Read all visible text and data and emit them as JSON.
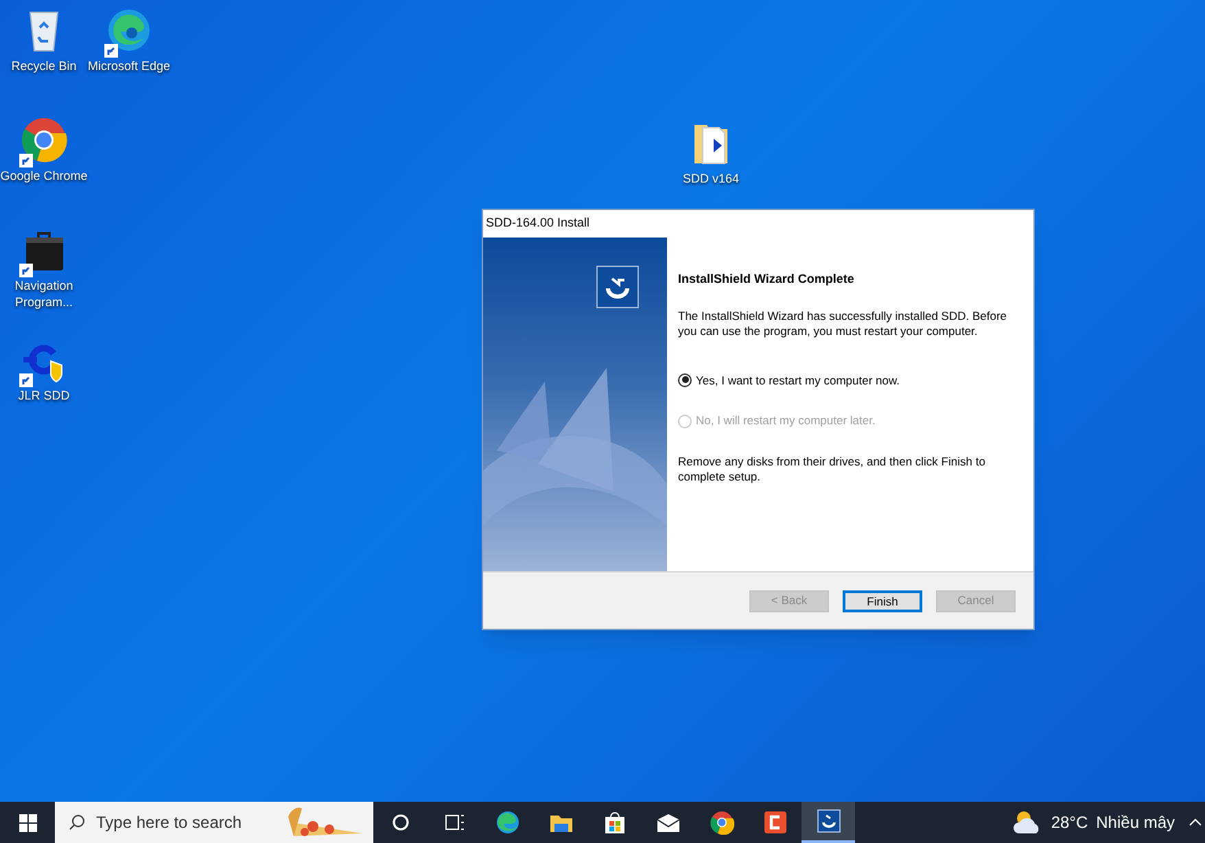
{
  "desktop_icons": [
    {
      "kind": "recycle-bin",
      "label": "Recycle Bin"
    },
    {
      "kind": "edge",
      "label": "Microsoft Edge"
    },
    {
      "kind": "chrome",
      "label": "Google Chrome"
    },
    {
      "kind": "briefcase",
      "label": "Navigation Program..."
    },
    {
      "kind": "jlr",
      "label": "JLR SDD"
    },
    {
      "kind": "folder",
      "label": "SDD v164"
    }
  ],
  "dialog": {
    "title": "SDD-164.00 Install",
    "heading": "InstallShield Wizard Complete",
    "message": "The InstallShield Wizard has successfully installed SDD. Before you can use the program, you must restart your computer.",
    "options": [
      {
        "label": "Yes, I want to restart my computer now.",
        "selected": true,
        "disabled": false
      },
      {
        "label": "No, I will restart my computer later.",
        "selected": false,
        "disabled": true
      }
    ],
    "note": "Remove any disks from their drives, and then click Finish to complete setup.",
    "buttons": [
      {
        "label": "< Back",
        "disabled": true,
        "default": false
      },
      {
        "label": "Finish",
        "disabled": false,
        "default": true
      },
      {
        "label": "Cancel",
        "disabled": true,
        "default": false
      }
    ]
  },
  "taskbar": {
    "search": {
      "placeholder": "Type here to search"
    },
    "apps": [
      {
        "kind": "cortana",
        "active": false
      },
      {
        "kind": "task-view",
        "active": false
      },
      {
        "kind": "edge",
        "active": false
      },
      {
        "kind": "explorer",
        "active": false
      },
      {
        "kind": "store",
        "active": false
      },
      {
        "kind": "mail",
        "active": false
      },
      {
        "kind": "chrome",
        "active": false
      },
      {
        "kind": "red-app",
        "active": false
      },
      {
        "kind": "installer",
        "active": true
      }
    ],
    "weather": {
      "temperature": "28°C",
      "condition": "Nhiều mây"
    }
  }
}
